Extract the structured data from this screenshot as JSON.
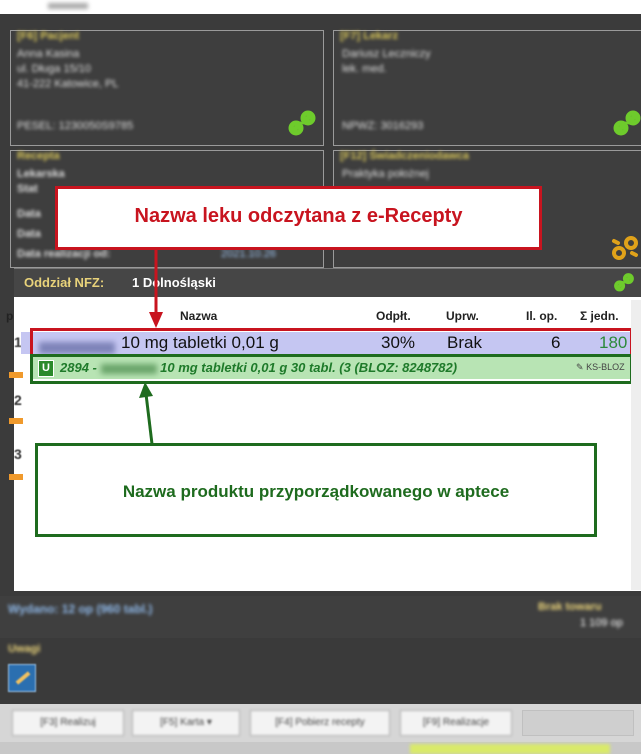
{
  "panels": {
    "patient": {
      "title": "[F6] Pacjent",
      "lines": [
        "Anna Kasina",
        "ul. Długa 15/10",
        "41-222 Katowice, PL"
      ],
      "pesel": "PESEL: 1230050S9785"
    },
    "doctor": {
      "title": "[F7] Lekarz",
      "lines": [
        "Dariusz Leczniczy",
        "lek. med."
      ],
      "npwz": "NPWZ: 3016293"
    },
    "prescription": {
      "title": "Recepta",
      "lines": [
        "Lekarska",
        "Stat",
        "Data",
        "Data",
        "Data realizacji od:"
      ],
      "date": "2021.10.26"
    },
    "provider": {
      "title": "[F12] Świadczeniodawca",
      "lines": [
        "Praktyka położnej"
      ]
    }
  },
  "nfz": {
    "label": "Oddział NFZ:",
    "value": "1 Dolnośląski"
  },
  "table": {
    "headers": [
      "p",
      "Nazwa",
      "Odpłt.",
      "Uprw.",
      "Il. op.",
      "Σ jedn."
    ],
    "row_numbers": [
      "1",
      "2",
      "3"
    ],
    "row1": {
      "name": "10 mg tabletki 0,01 g",
      "odplatnosc": "30%",
      "uprawnienia": "Brak",
      "il_op": "6",
      "suma": "180"
    },
    "row2": {
      "badge": "U",
      "code": "2894 -",
      "name": "10 mg tabletki 0,01 g 30 tabl. (3  (BLOZ: 8248782)",
      "tag": "KS-BLOZ"
    }
  },
  "callouts": {
    "top": "Nazwa leku odczytana z e-Recepty",
    "bottom": "Nazwa produktu przyporządkowanego w aptece"
  },
  "status": {
    "issued": "Wydano: 12 op (960 tabl.)",
    "right_label": "Brak towaru",
    "right_value": "1 109 op"
  },
  "notes": {
    "label": "Uwagi"
  },
  "buttons": [
    "[F3] Realizuj",
    "[F5] Karta ▾",
    "[F4] Pobierz recepty",
    "[F9] Realizacje"
  ],
  "colors": {
    "accent_red": "#c8141f",
    "accent_green": "#1e6b1e",
    "row_blue": "#c5c6f2",
    "row_green": "#b8e4b4",
    "panel_gold": "#d8c65a"
  }
}
